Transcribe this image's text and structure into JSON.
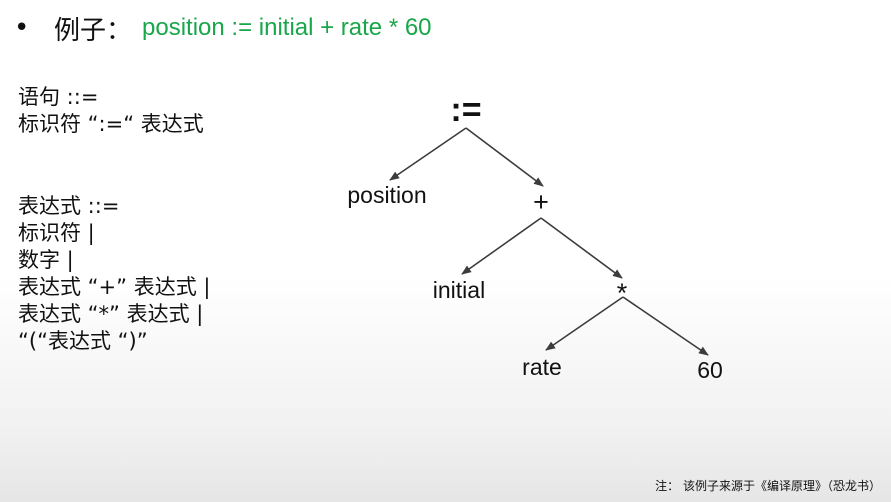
{
  "slide": {
    "bullet": "•",
    "title_label": "例子：",
    "title_expr": "position := initial  + rate * 60"
  },
  "grammar": {
    "statement": [
      "语句 ::=",
      "标识符 “:=“ 表达式"
    ],
    "expression": [
      "表达式 ::=",
      "标识符 |",
      "数字 |",
      "表达式 “+” 表达式 |",
      "表达式 “*” 表达式 |",
      "“(“表达式 “)”"
    ]
  },
  "tree": {
    "root": ":=",
    "assign_left": "position",
    "plus": "+",
    "plus_left": "initial",
    "times": "*",
    "times_left": "rate",
    "times_right": "60"
  },
  "footnote": "注： 该例子来源于《编译原理》（恐龙书）",
  "colors": {
    "title_expr": "#1aa64a",
    "edge": "#3c3c3c",
    "text": "#111111"
  }
}
